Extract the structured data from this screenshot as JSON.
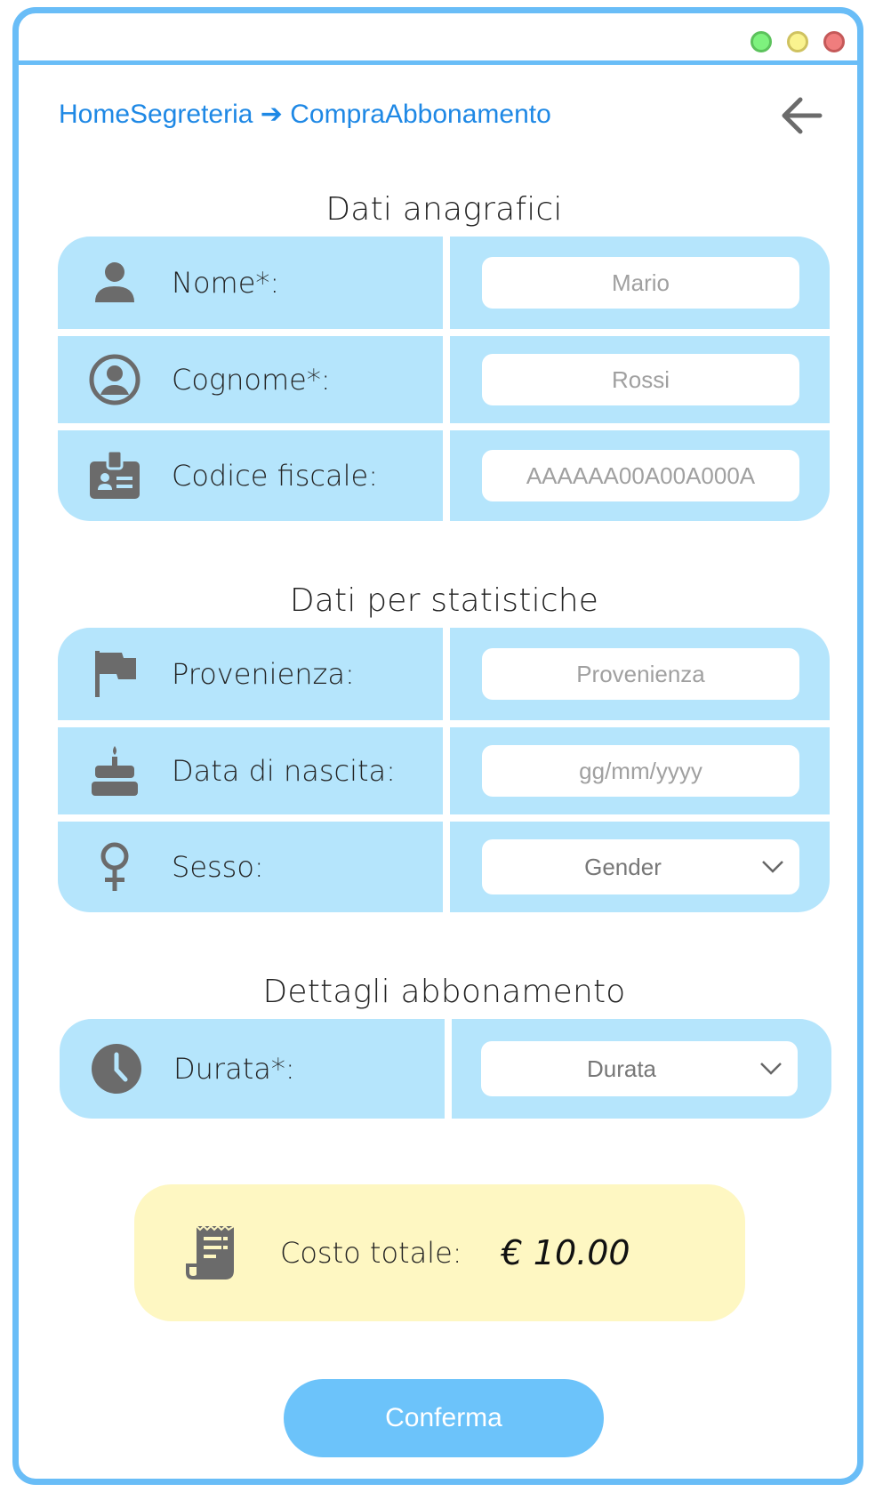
{
  "breadcrumb": {
    "home": "HomeSegreteria",
    "arrow": "➔",
    "current": "CompraAbbonamento"
  },
  "sections": {
    "anagrafici": "Dati anagrafici",
    "statistiche": "Dati per statistiche",
    "abbonamento": "Dettagli abbonamento"
  },
  "fields": {
    "nome": {
      "label": "Nome*:",
      "placeholder": "Mario",
      "icon": "person-icon"
    },
    "cognome": {
      "label": "Cognome*:",
      "placeholder": "Rossi",
      "icon": "account-circle-icon"
    },
    "codice": {
      "label": "Codice fiscale:",
      "placeholder": "AAAAAA00A00A000A",
      "icon": "id-badge-icon"
    },
    "provenienza": {
      "label": "Provenienza:",
      "placeholder": "Provenienza",
      "icon": "flag-icon"
    },
    "nascita": {
      "label": "Data di nascita:",
      "placeholder": "gg/mm/yyyy",
      "icon": "cake-icon"
    },
    "sesso": {
      "label": "Sesso:",
      "selected": "Gender",
      "icon": "female-icon"
    },
    "durata": {
      "label": "Durata*:",
      "selected": "Durata",
      "icon": "clock-icon"
    }
  },
  "total": {
    "label": "Costo totale:",
    "amount": "€ 10.00",
    "icon": "receipt-icon"
  },
  "confirm_label": "Conferma",
  "colors": {
    "accent": "#69bdf7",
    "panel": "#b5e5fc",
    "total_bg": "#fef7c2",
    "link": "#1e88e5",
    "icon": "#6b6b6b"
  }
}
